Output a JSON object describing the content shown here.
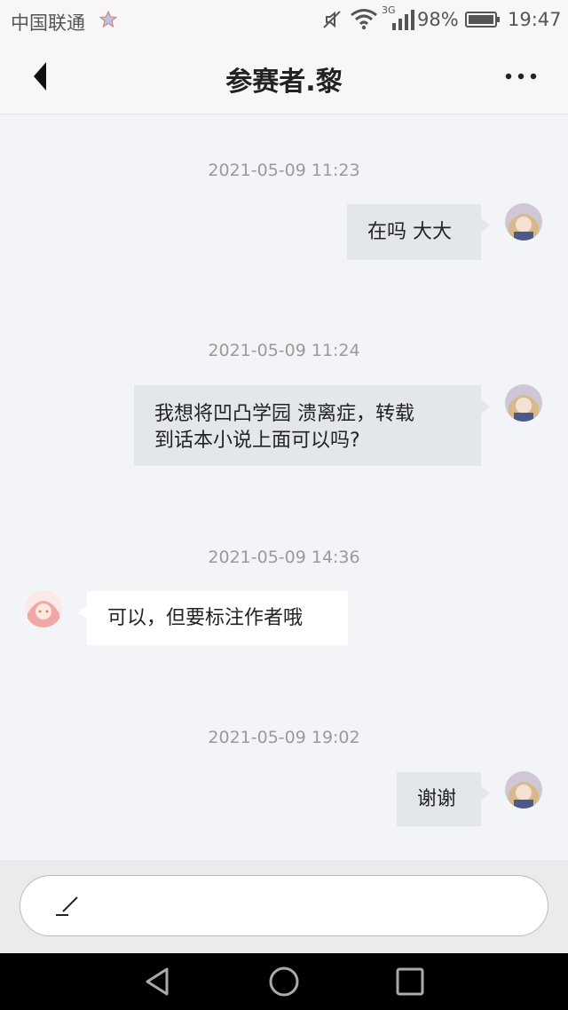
{
  "status_bar": {
    "carrier": "中国联通",
    "network": "3G",
    "battery": "98%",
    "time": "19:47"
  },
  "nav": {
    "title": "参赛者.黎",
    "back_icon": "chevron-left-icon",
    "more_icon": "more-horizontal-icon"
  },
  "messages": [
    {
      "time": "2021-05-09 11:23",
      "direction": "out",
      "text": "在吗 大大"
    },
    {
      "time": "2021-05-09 11:24",
      "direction": "out",
      "text_line1": "我想将凹凸学园 溃离症，转载",
      "text_line2": "到话本小说上面可以吗?"
    },
    {
      "time": "2021-05-09 14:36",
      "direction": "in",
      "text": "可以，但要标注作者哦"
    },
    {
      "time": "2021-05-09 19:02",
      "direction": "out",
      "text": "谢谢"
    }
  ],
  "composer": {
    "icon": "pen-icon"
  },
  "colors": {
    "outgoing_bubble": "#e3e7ec",
    "incoming_bubble": "#ffffff",
    "chat_background": "#f3f4f8"
  }
}
